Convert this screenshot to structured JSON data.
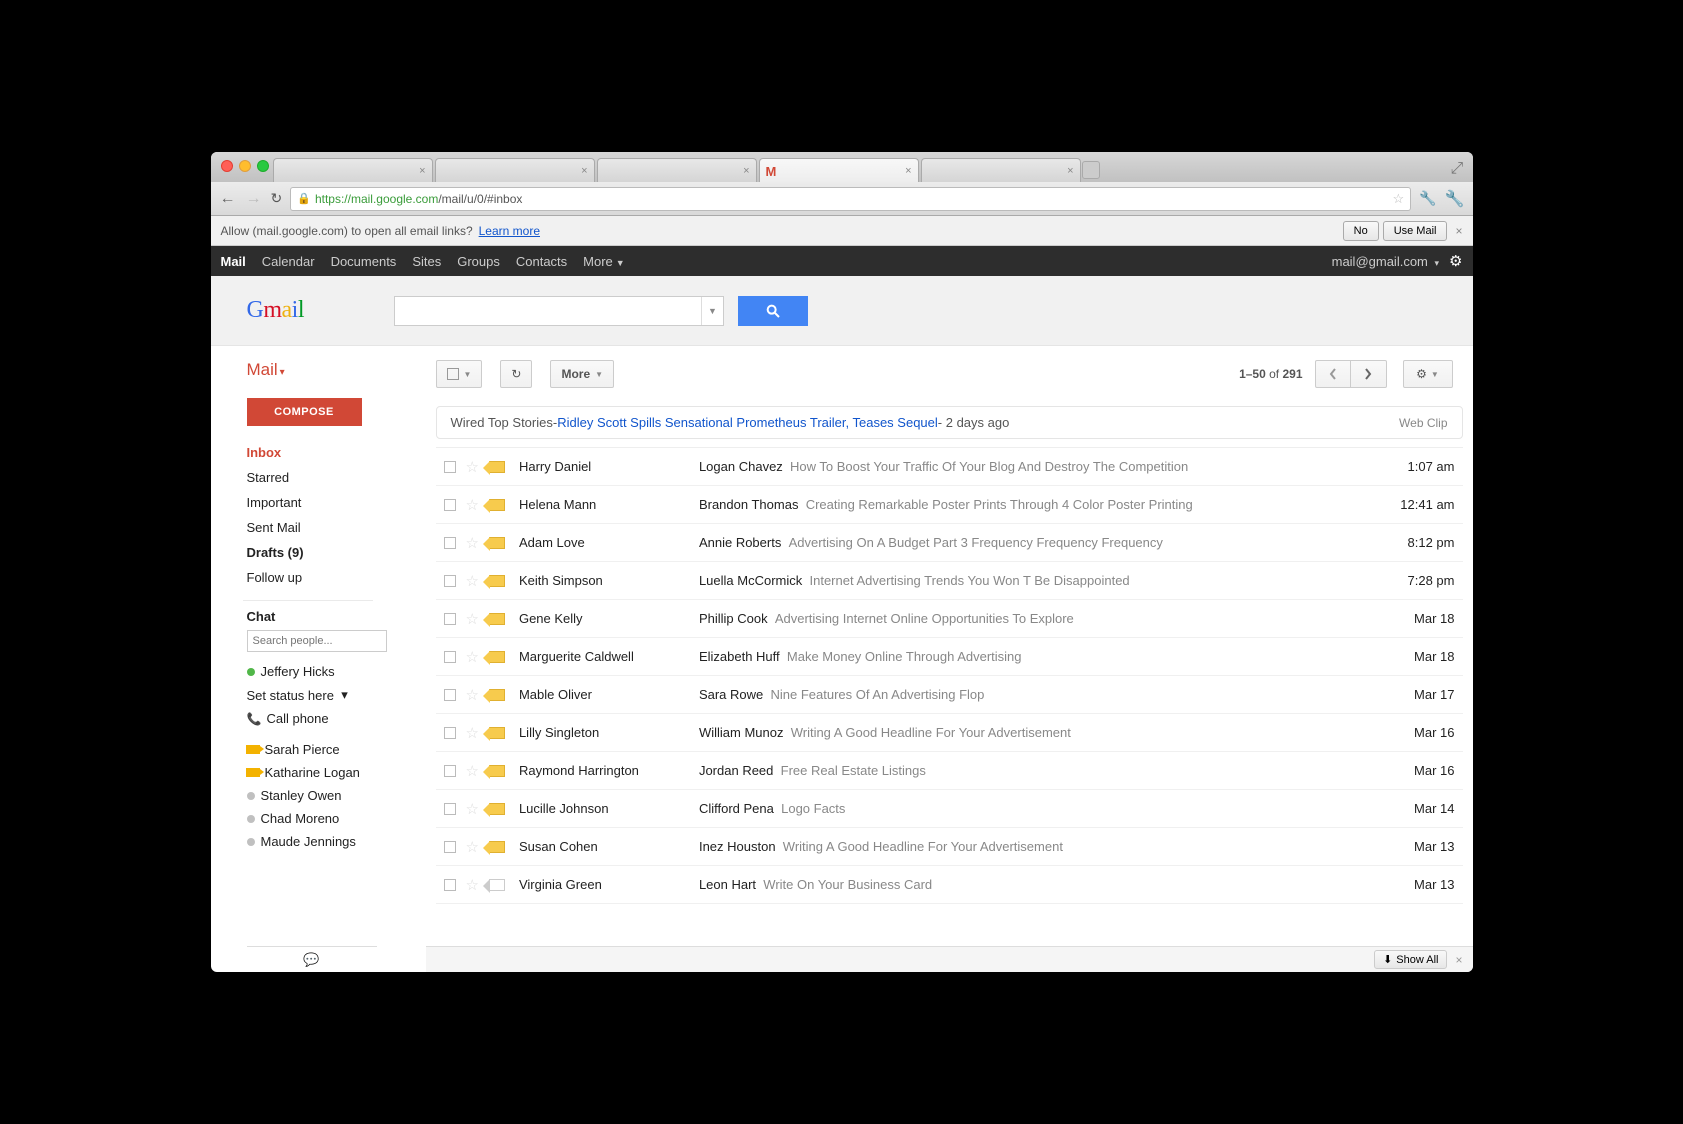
{
  "url": {
    "protocol": "https://",
    "host": "mail.google.com",
    "path": "/mail/u/0/#inbox"
  },
  "infobar": {
    "text": "Allow (mail.google.com) to open all email links?",
    "learn": "Learn more",
    "no": "No",
    "use": "Use Mail"
  },
  "gbar": {
    "items": [
      "Mail",
      "Calendar",
      "Documents",
      "Sites",
      "Groups",
      "Contacts",
      "More"
    ],
    "email": "mail@gmail.com"
  },
  "mailLabel": "Mail",
  "compose": "COMPOSE",
  "nav": [
    {
      "label": "Inbox",
      "active": true
    },
    {
      "label": "Starred"
    },
    {
      "label": "Important"
    },
    {
      "label": "Sent Mail"
    },
    {
      "label": "Drafts (9)",
      "bold": true
    },
    {
      "label": "Follow up"
    }
  ],
  "chat": {
    "header": "Chat",
    "placeholder": "Search people...",
    "me": "Jeffery Hicks",
    "status": "Set status here",
    "callphone": "Call phone",
    "contacts": [
      {
        "name": "Sarah Pierce",
        "cam": true
      },
      {
        "name": "Katharine Logan",
        "cam": true
      },
      {
        "name": "Stanley Owen",
        "dot": "gray"
      },
      {
        "name": "Chad Moreno",
        "dot": "gray"
      },
      {
        "name": "Maude Jennings",
        "dot": "gray"
      }
    ]
  },
  "toolbar": {
    "more": "More",
    "range": "1–50",
    "of": "of",
    "total": "291"
  },
  "webclip": {
    "src": "Wired Top Stories",
    "dash": " - ",
    "link": "Ridley Scott Spills Sensational Prometheus Trailer, Teases Sequel",
    "ago": " - 2 days ago",
    "label": "Web Clip"
  },
  "rows": [
    {
      "sender": "Harry Daniel",
      "bold": "Logan Chavez",
      "rest": "How To Boost Your Traffic Of Your Blog And Destroy The Competition",
      "date": "1:07 am",
      "tag": "yellow"
    },
    {
      "sender": "Helena Mann",
      "bold": "Brandon Thomas",
      "rest": "Creating Remarkable Poster Prints Through 4 Color Poster Printing",
      "date": "12:41 am",
      "tag": "yellow"
    },
    {
      "sender": "Adam Love",
      "bold": "Annie Roberts",
      "rest": "Advertising On A Budget Part 3 Frequency Frequency Frequency",
      "date": "8:12 pm",
      "tag": "yellow"
    },
    {
      "sender": "Keith Simpson",
      "bold": "Luella McCormick",
      "rest": "Internet Advertising Trends You Won T Be Disappointed",
      "date": "7:28 pm",
      "tag": "yellow"
    },
    {
      "sender": "Gene Kelly",
      "bold": "Phillip Cook",
      "rest": "Advertising Internet Online Opportunities To Explore",
      "date": "Mar 18",
      "tag": "yellow"
    },
    {
      "sender": "Marguerite Caldwell",
      "bold": "Elizabeth Huff",
      "rest": "Make Money Online Through Advertising",
      "date": "Mar 18",
      "tag": "yellow"
    },
    {
      "sender": "Mable Oliver",
      "bold": "Sara Rowe",
      "rest": "Nine Features Of An Advertising Flop",
      "date": "Mar 17",
      "tag": "yellow"
    },
    {
      "sender": "Lilly Singleton",
      "bold": "William Munoz",
      "rest": "Writing A Good Headline For Your Advertisement",
      "date": "Mar 16",
      "tag": "yellow"
    },
    {
      "sender": "Raymond Harrington",
      "bold": "Jordan Reed",
      "rest": "Free Real Estate Listings",
      "date": "Mar 16",
      "tag": "yellow"
    },
    {
      "sender": "Lucille Johnson",
      "bold": "Clifford Pena",
      "rest": "Logo Facts",
      "date": "Mar 14",
      "tag": "yellow"
    },
    {
      "sender": "Susan Cohen",
      "bold": "Inez Houston",
      "rest": "Writing A Good Headline For Your Advertisement",
      "date": "Mar 13",
      "tag": "yellow"
    },
    {
      "sender": "Virginia Green",
      "bold": "Leon Hart",
      "rest": "Write On Your Business Card",
      "date": "Mar 13",
      "tag": "gray"
    }
  ],
  "showAll": "Show All"
}
